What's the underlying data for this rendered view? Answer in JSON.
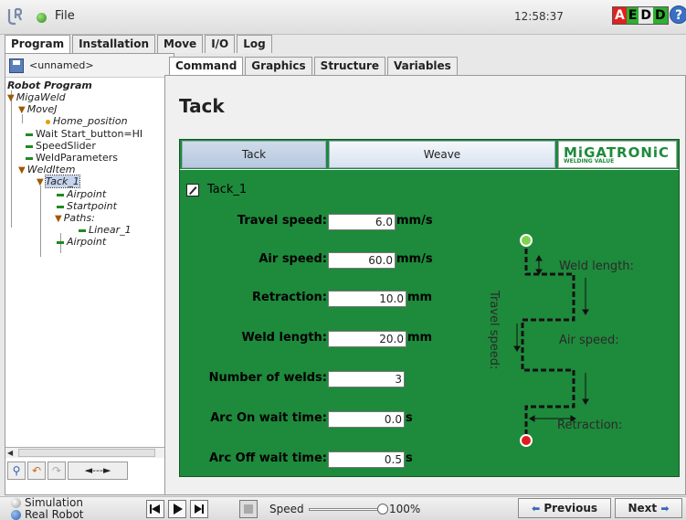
{
  "topbar": {
    "file_label": "File",
    "clock": "12:58:37",
    "aedd": [
      "A",
      "E",
      "D",
      "D"
    ],
    "aedd_colors": [
      "#e32020",
      "#2fb02f",
      "#e8e8e8",
      "#2fb02f"
    ],
    "help": "?"
  },
  "main_tabs": [
    {
      "label": "Program",
      "active": true
    },
    {
      "label": "Installation",
      "active": false
    },
    {
      "label": "Move",
      "active": false
    },
    {
      "label": "I/O",
      "active": false
    },
    {
      "label": "Log",
      "active": false
    }
  ],
  "program_name": "<unnamed>",
  "tree": {
    "root": "Robot Program",
    "items": [
      "MigaWeld",
      "MoveJ",
      "Home_position",
      "Wait Start_button=HI",
      "SpeedSlider",
      "WeldParameters",
      "WeldItem",
      "Tack_1",
      "Airpoint",
      "Startpoint",
      "Paths:",
      "Linear_1",
      "Airpoint"
    ],
    "toolbar_wide": "◄---►"
  },
  "sub_tabs": [
    {
      "label": "Command",
      "active": true
    },
    {
      "label": "Graphics",
      "active": false
    },
    {
      "label": "Structure",
      "active": false
    },
    {
      "label": "Variables",
      "active": false
    }
  ],
  "page_title": "Tack",
  "panel": {
    "tabs": [
      {
        "label": "Tack",
        "active": true
      },
      {
        "label": "Weave",
        "active": false
      }
    ],
    "brand_main": "MiGATRONiC",
    "brand_sub": "WELDING VALUE",
    "item_name": "Tack_1",
    "fields": [
      {
        "label": "Travel speed:",
        "value": "6.0",
        "unit": "mm/s"
      },
      {
        "label": "Air speed:",
        "value": "60.0",
        "unit": "mm/s"
      },
      {
        "label": "Retraction:",
        "value": "10.0",
        "unit": "mm"
      },
      {
        "label": "Weld length:",
        "value": "20.0",
        "unit": "mm"
      },
      {
        "label": "Number of welds:",
        "value": "3",
        "unit": ""
      },
      {
        "label": "Arc On wait time:",
        "value": "0.0",
        "unit": "s"
      },
      {
        "label": "Arc Off wait time:",
        "value": "0.5",
        "unit": "s"
      }
    ],
    "diagram": {
      "weld_length": "Weld length:",
      "air_speed": "Air speed:",
      "retraction": "Retraction:",
      "travel_speed": "Travel speed:",
      "colors": {
        "panel": "#1e8a3c",
        "start": "#7dd44a",
        "end": "#e11b1b"
      }
    }
  },
  "bottom": {
    "simulation": "Simulation",
    "real_robot": "Real Robot",
    "speed_label": "Speed",
    "speed_value": "100%",
    "speed_fraction": 1.0,
    "previous": "Previous",
    "next": "Next"
  }
}
